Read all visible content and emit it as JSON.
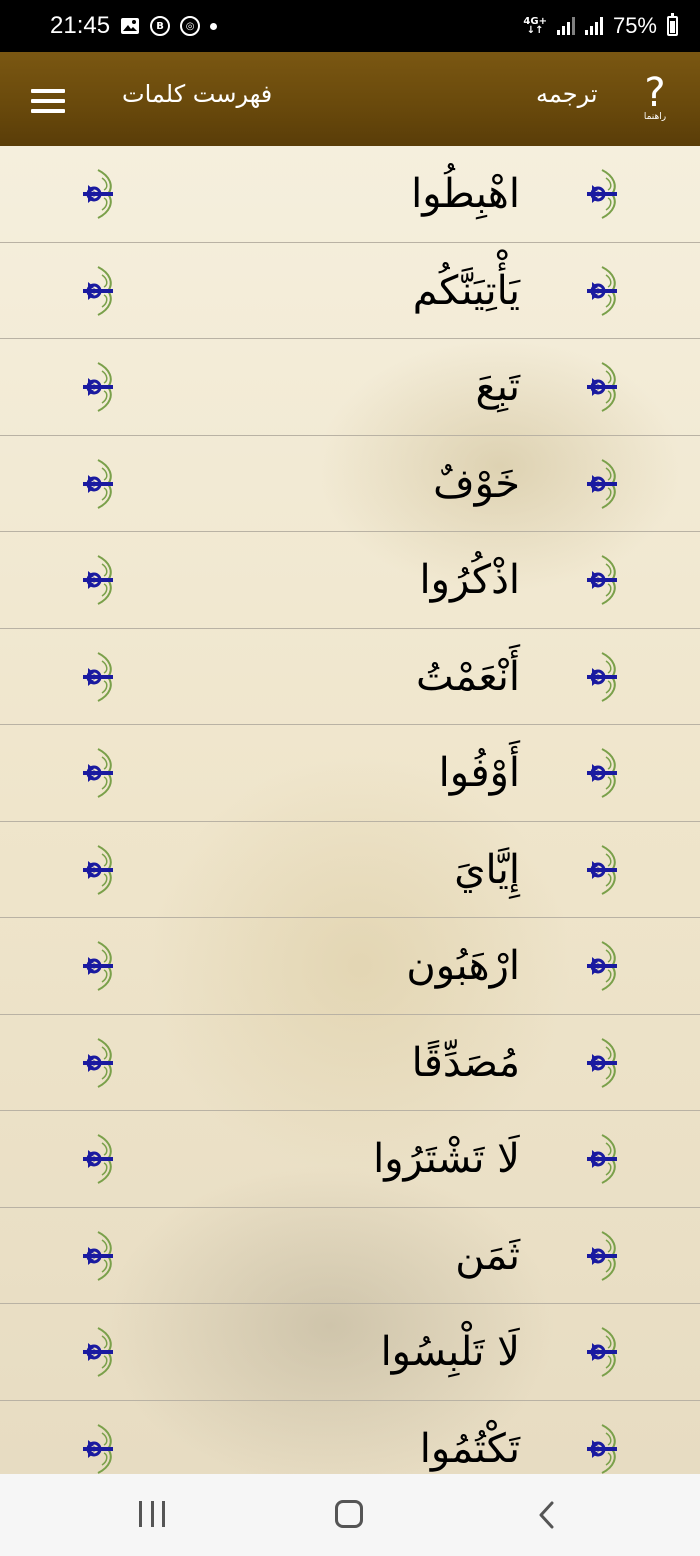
{
  "status_bar": {
    "time": "21:45",
    "network": "4G+",
    "battery": "75%",
    "icons": [
      "image-icon",
      "b-app-icon",
      "circle-app-icon",
      "notification-dot"
    ]
  },
  "app_bar": {
    "help_label": "راهنما",
    "translation_label": "ترجمه",
    "title": "فهرست کلمات",
    "menu_icon": "hamburger-menu-icon"
  },
  "words": [
    "اهْبِطُوا",
    "يَأْتِيَنَّكُم",
    "تَبِعَ",
    "خَوْفٌ",
    "اذْكُرُوا",
    "أَنْعَمْتُ",
    "أَوْفُوا",
    "إِيَّايَ",
    "ارْهَبُون",
    "مُصَدِّقًا",
    "لَا تَشْتَرُوا",
    "ثَمَن",
    "لَا تَلْبِسُوا",
    "تَكْتُمُوا"
  ],
  "colors": {
    "app_bar": "#6a4a0c",
    "ornament": "#1a1aa0",
    "ornament_leaf": "#7aa04a",
    "divider": "#b9b2a4"
  }
}
